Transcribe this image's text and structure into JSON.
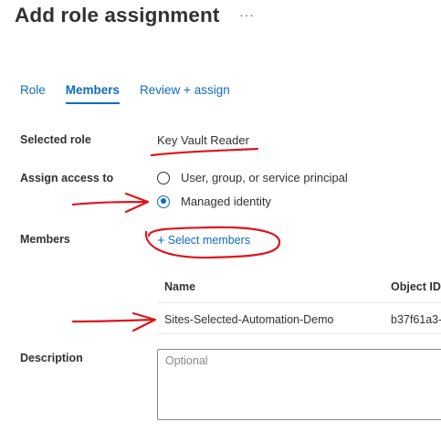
{
  "header": {
    "title": "Add role assignment",
    "more_label": "···"
  },
  "tabs": [
    {
      "label": "Role",
      "active": false
    },
    {
      "label": "Members",
      "active": true
    },
    {
      "label": "Review + assign",
      "active": false
    }
  ],
  "form": {
    "selected_role": {
      "label": "Selected role",
      "value": "Key Vault Reader"
    },
    "assign_access": {
      "label": "Assign access to",
      "options": [
        {
          "label": "User, group, or service principal",
          "checked": false
        },
        {
          "label": "Managed identity",
          "checked": true
        }
      ]
    },
    "members": {
      "label": "Members",
      "select_link_label": "Select members",
      "plus_icon": "+",
      "columns": [
        "Name",
        "Object ID"
      ],
      "rows": [
        {
          "name": "Sites-Selected-Automation-Demo",
          "object_id": "b37f61a3-"
        }
      ]
    },
    "description": {
      "label": "Description",
      "placeholder": "Optional"
    }
  },
  "colors": {
    "accent": "#0f6cbd",
    "annotation": "#e0141c",
    "text": "#323130"
  }
}
